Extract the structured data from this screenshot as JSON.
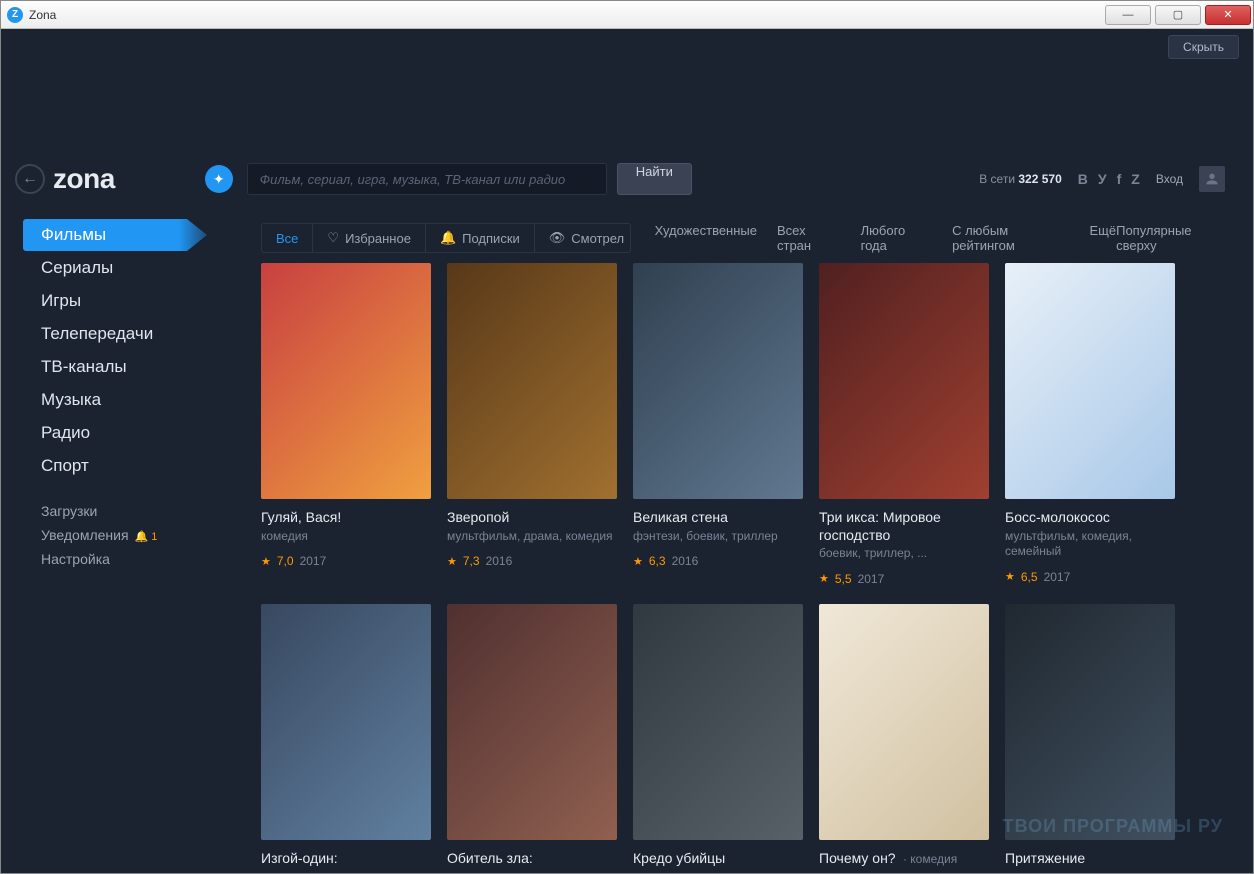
{
  "window": {
    "title": "Zona"
  },
  "hide_button": "Скрыть",
  "logo": "zona",
  "search": {
    "placeholder": "Фильм, сериал, игра, музыка, ТВ-канал или радио",
    "button": "Найти"
  },
  "online": {
    "label": "В сети",
    "count": "322 570"
  },
  "login_label": "Вход",
  "sidebar": {
    "items": [
      "Фильмы",
      "Сериалы",
      "Игры",
      "Телепередачи",
      "ТВ-каналы",
      "Музыка",
      "Радио",
      "Спорт"
    ],
    "active_index": 0,
    "secondary": [
      {
        "label": "Загрузки"
      },
      {
        "label": "Уведомления",
        "badge": "1"
      },
      {
        "label": "Настройка"
      }
    ]
  },
  "view_tabs": [
    {
      "label": "Все",
      "active": true
    },
    {
      "label": "Избранное",
      "icon": "heart"
    },
    {
      "label": "Подписки",
      "icon": "bell"
    },
    {
      "label": "Смотрел",
      "icon": "eye"
    }
  ],
  "filters": [
    "Художественные",
    "Всех стран",
    "Любого года",
    "С любым рейтингом",
    "Ещё"
  ],
  "sort": "Популярные сверху",
  "movies": [
    {
      "title": "Гуляй, Вася!",
      "genre": "комедия",
      "rating": "7,0",
      "year": "2017"
    },
    {
      "title": "Зверопой",
      "genre": "мультфильм, драма, комедия",
      "rating": "7,3",
      "year": "2016"
    },
    {
      "title": "Великая стена",
      "genre": "фэнтези, боевик, триллер",
      "rating": "6,3",
      "year": "2016"
    },
    {
      "title": "Три икса: Мировое господство",
      "genre": "боевик, триллер, ...",
      "rating": "5,5",
      "year": "2017"
    },
    {
      "title": "Босс-молокосос",
      "genre": "мультфильм, комедия, семейный",
      "rating": "6,5",
      "year": "2017"
    },
    {
      "title": "Изгой-один:",
      "genre": "",
      "rating": "",
      "year": ""
    },
    {
      "title": "Обитель зла:",
      "genre": "",
      "rating": "",
      "year": ""
    },
    {
      "title": "Кредо убийцы",
      "genre": "",
      "rating": "",
      "year": ""
    },
    {
      "title": "Почему он?",
      "genre": "комедия",
      "inline_genre": true,
      "rating": "",
      "year": ""
    },
    {
      "title": "Притяжение",
      "genre": "",
      "rating": "",
      "year": ""
    }
  ],
  "watermark": "ТВОИ ПРОГРАММЫ РУ"
}
